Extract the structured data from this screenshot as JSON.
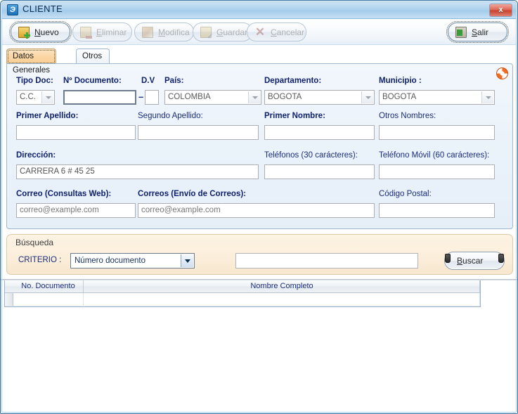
{
  "window": {
    "title": "CLIENTE",
    "icon": "app-icon",
    "close_label": "x"
  },
  "toolbar": {
    "buttons": [
      {
        "label": "Nuevo",
        "accel": "N",
        "icon": "new-document-icon",
        "enabled": true,
        "focused": true
      },
      {
        "label": "Eliminar",
        "accel": "E",
        "icon": "delete-document-icon",
        "enabled": false,
        "focused": false
      },
      {
        "label": "Modifica",
        "accel": "M",
        "icon": "pencil-edit-icon",
        "enabled": false,
        "focused": false
      },
      {
        "label": "Guardar",
        "accel": "G",
        "icon": "save-document-icon",
        "enabled": false,
        "focused": false
      },
      {
        "label": "Cancelar",
        "accel": "C",
        "icon": "cancel-x-icon",
        "enabled": false,
        "focused": false
      }
    ],
    "exit": {
      "label": "Salir",
      "accel": "S",
      "icon": "exit-door-icon",
      "enabled": true,
      "focused": true
    }
  },
  "tabs": [
    {
      "label": "Datos Generales",
      "active": true
    },
    {
      "label": "Otros Datos",
      "active": false
    }
  ],
  "form": {
    "help_icon": "lifesaver-help-icon",
    "separator": "–",
    "fields": {
      "tipo_doc": {
        "label": "Tipo Doc:",
        "value": "C.C.",
        "required": true
      },
      "num_documento": {
        "label": "Nº Documento:",
        "value": "",
        "required": true
      },
      "dv": {
        "label": "D.V",
        "value": "",
        "required": true
      },
      "pais": {
        "label": "País:",
        "value": "COLOMBIA",
        "required": true
      },
      "departamento": {
        "label": "Departamento:",
        "value": "BOGOTA",
        "required": true
      },
      "municipio": {
        "label": "Municipio :",
        "value": "BOGOTA",
        "required": true
      },
      "primer_apellido": {
        "label": "Primer Apellido:",
        "value": "",
        "required": true
      },
      "segundo_apellido": {
        "label": "Segundo Apellido:",
        "value": "",
        "required": false
      },
      "primer_nombre": {
        "label": "Primer Nombre:",
        "value": "",
        "required": true
      },
      "otros_nombres": {
        "label": "Otros Nombres:",
        "value": "",
        "required": false
      },
      "direccion": {
        "label": "Dirección:",
        "value": "CARRERA 6 # 45 25",
        "required": true
      },
      "telefonos": {
        "label": "Teléfonos (30 carácteres):",
        "value": "",
        "required": false
      },
      "telefono_movil": {
        "label": "Teléfono Móvil (60 carácteres):",
        "value": "",
        "required": false
      },
      "correo_consultas": {
        "label": "Correo (Consultas Web):",
        "value": "correo@example.com",
        "required": true
      },
      "correos_envio": {
        "label": "Correos (Envío de Correos):",
        "value": "correo@example.com",
        "required": true
      },
      "codigo_postal": {
        "label": "Código Postal:",
        "value": "",
        "required": false
      }
    }
  },
  "busqueda": {
    "title": "Búsqueda",
    "criterio_label": "CRITERIO :",
    "criterio_value": "Número documento",
    "search_value": "",
    "search_placeholder": "",
    "buscar": {
      "label": "Buscar",
      "accel": "B",
      "icon": "binoculars-icon"
    }
  },
  "grid": {
    "columns": [
      "No. Documento",
      "Nombre Completo"
    ],
    "rows": [
      {
        "no_documento": "",
        "nombre_completo": ""
      }
    ]
  },
  "colors": {
    "label_blue": "#1b2d7a",
    "titlebar_blue": "#a4cbea",
    "tab_active_orange": "#fbd5a2",
    "busqueda_cream": "#fbeedb",
    "close_red": "#c8442f"
  }
}
